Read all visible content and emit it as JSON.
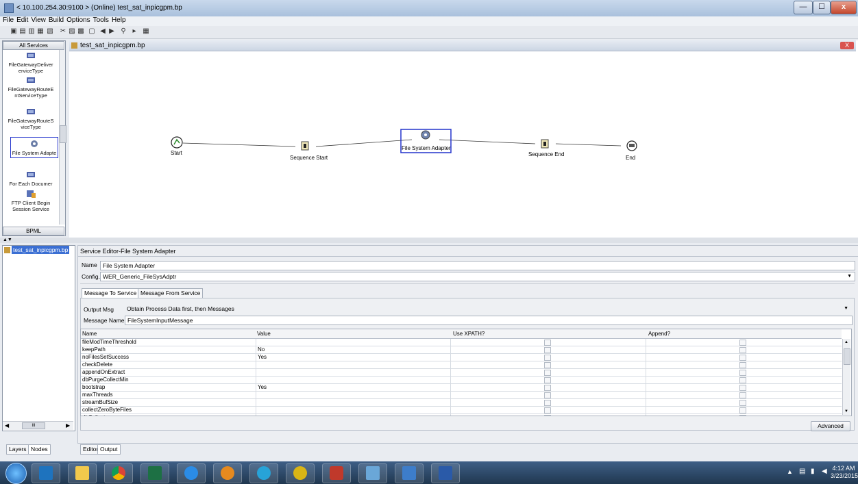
{
  "window": {
    "title": "< 10.100.254.30:9100 > (Online) test_sat_inpicgpm.bp",
    "minimize": "—",
    "maximize": "☐",
    "close": "x"
  },
  "menubar": [
    "File",
    "Edit",
    "View",
    "Build",
    "Options",
    "Tools",
    "Help"
  ],
  "palette": {
    "header": "All Services",
    "footer": "BPML",
    "items": [
      {
        "label": "FileGatewayDeliverServiceType",
        "lines": [
          "FileGatewayDeliver",
          "erviceType"
        ]
      },
      {
        "label": "FileGatewayRouteEntServiceType",
        "lines": [
          "FileGatewayRouteE",
          "ntServiceType"
        ]
      },
      {
        "label": "FileGatewayRouteServiceType",
        "lines": [
          "FileGatewayRouteS",
          "viceType"
        ]
      },
      {
        "label": "File System Adapter",
        "lines": [
          "File System Adapte"
        ]
      },
      {
        "label": "For Each Document",
        "lines": [
          "For Each Documer"
        ]
      },
      {
        "label": "FTP Client Begin Session Service",
        "lines": [
          "FTP Client Begin",
          "Session Service"
        ]
      }
    ]
  },
  "canvas": {
    "tab_title": "test_sat_inpicgpm.bp",
    "close": "X",
    "nodes": [
      {
        "label": "Start"
      },
      {
        "label": "Sequence Start"
      },
      {
        "label": "File System Adapter"
      },
      {
        "label": "Sequence End"
      },
      {
        "label": "End"
      }
    ]
  },
  "tree": {
    "selected": "test_sat_inpicgpm.bp",
    "tabs": [
      "Layers",
      "Nodes"
    ],
    "scroll_text": "III"
  },
  "editor": {
    "title": "Service Editor-File System Adapter",
    "name_label": "Name",
    "name_value": "File System Adapter",
    "config_label": "Config.",
    "config_value": "WER_Generic_FileSysAdptr",
    "tabs": [
      "Message To Service",
      "Message From Service"
    ],
    "output_label": "Output Msg",
    "output_value": "Obtain Process Data first, then Messages",
    "msgname_label": "Message Name",
    "msgname_value": "FileSystemInputMessage",
    "columns": [
      "Name",
      "Value",
      "Use XPATH?",
      "Append?"
    ],
    "rows": [
      {
        "name": "fileModTimeThreshold",
        "value": ""
      },
      {
        "name": "keepPath",
        "value": "No"
      },
      {
        "name": "noFilesSetSuccess",
        "value": "Yes"
      },
      {
        "name": "checkDelete",
        "value": ""
      },
      {
        "name": "appendOnExtract",
        "value": ""
      },
      {
        "name": "dbPurgeCollectMin",
        "value": ""
      },
      {
        "name": "bootstrap",
        "value": "Yes"
      },
      {
        "name": "maxThreads",
        "value": ""
      },
      {
        "name": "streamBufSize",
        "value": ""
      },
      {
        "name": "collectZeroByteFiles",
        "value": ""
      },
      {
        "name": "dbCollect",
        "value": ""
      }
    ],
    "advanced": "Advanced",
    "bottom_tabs": [
      "Editor",
      "Output"
    ]
  },
  "taskbar": {
    "time": "4:12 AM",
    "date": "3/23/2015",
    "apps": [
      "windows-start",
      "outlook",
      "file-explorer",
      "chrome",
      "excel",
      "internet-explorer",
      "app-orange",
      "app-globe",
      "ultraedit",
      "app-red",
      "app-notepad",
      "remote-desktop",
      "word"
    ]
  },
  "colors": {
    "selection": "#3b6fd3",
    "node_border": "#2233cc"
  }
}
